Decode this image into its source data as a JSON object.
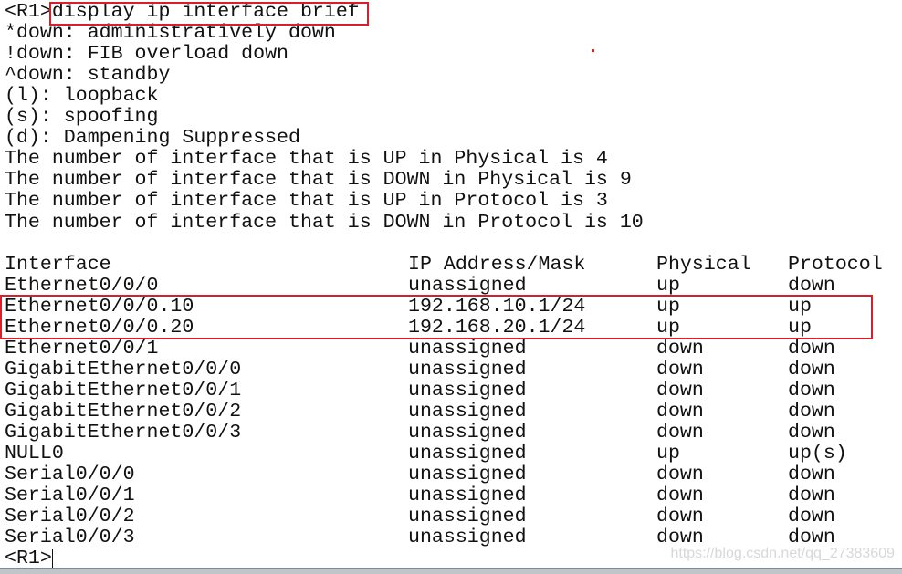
{
  "terminal": {
    "prompt": "<R1>",
    "command": "display ip interface brief",
    "legend": [
      "*down: administratively down",
      "!down: FIB overload down",
      "^down: standby",
      "(l): loopback",
      "(s): spoofing",
      "(d): Dampening Suppressed"
    ],
    "summary": [
      "The number of interface that is UP in Physical is 4",
      "The number of interface that is DOWN in Physical is 9",
      "The number of interface that is UP in Protocol is 3",
      "The number of interface that is DOWN in Protocol is 10"
    ],
    "table": {
      "headers": [
        "Interface",
        "IP Address/Mask",
        "Physical",
        "Protocol"
      ],
      "rows": [
        [
          "Ethernet0/0/0",
          "unassigned",
          "up",
          "down"
        ],
        [
          "Ethernet0/0/0.10",
          "192.168.10.1/24",
          "up",
          "up"
        ],
        [
          "Ethernet0/0/0.20",
          "192.168.20.1/24",
          "up",
          "up"
        ],
        [
          "Ethernet0/0/1",
          "unassigned",
          "down",
          "down"
        ],
        [
          "GigabitEthernet0/0/0",
          "unassigned",
          "down",
          "down"
        ],
        [
          "GigabitEthernet0/0/1",
          "unassigned",
          "down",
          "down"
        ],
        [
          "GigabitEthernet0/0/2",
          "unassigned",
          "down",
          "down"
        ],
        [
          "GigabitEthernet0/0/3",
          "unassigned",
          "down",
          "down"
        ],
        [
          "NULL0",
          "unassigned",
          "up",
          "up(s)"
        ],
        [
          "Serial0/0/0",
          "unassigned",
          "down",
          "down"
        ],
        [
          "Serial0/0/1",
          "unassigned",
          "down",
          "down"
        ],
        [
          "Serial0/0/2",
          "unassigned",
          "down",
          "down"
        ],
        [
          "Serial0/0/3",
          "unassigned",
          "down",
          "down"
        ]
      ]
    },
    "final_prompt": "<R1>",
    "highlight_color": "#d9202a"
  },
  "watermark": "https://blog.csdn.net/qq_27383609"
}
